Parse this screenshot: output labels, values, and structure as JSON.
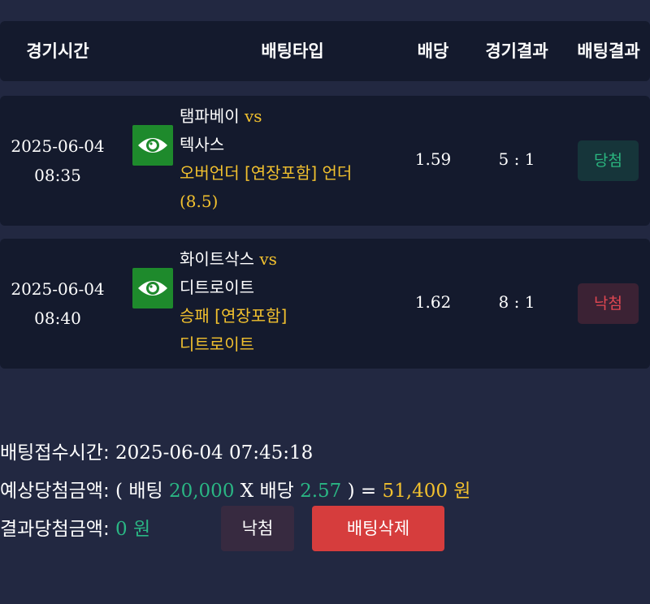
{
  "header": {
    "time": "경기시간",
    "bet_type": "배팅타입",
    "odds": "배당",
    "match_result": "경기결과",
    "bet_result": "배팅결과"
  },
  "rows": [
    {
      "date": "2025-06-04",
      "time": "08:35",
      "home": "탬파베이",
      "vs": "vs",
      "away": "텍사스",
      "bet_line1": "오버언더 [연장포함] 언더",
      "bet_line2": "(8.5)",
      "odds": "1.59",
      "score": "5 : 1",
      "result": "당첨",
      "result_color": "#2ab67f",
      "icon": "eye-icon"
    },
    {
      "date": "2025-06-04",
      "time": "08:40",
      "home": "화이트삭스",
      "vs": "vs",
      "away": "디트로이트",
      "bet_line1": "승패 [연장포함]",
      "bet_line2": "디트로이트",
      "odds": "1.62",
      "score": "8 : 1",
      "result": "낙첨",
      "result_color": "#e04752",
      "icon": "eye-icon"
    }
  ],
  "summary": {
    "receipt_label": "배팅접수시간:",
    "receipt_time": "2025-06-04 07:45:18",
    "expected_label": "예상당첨금액:",
    "open_paren": "(",
    "bet_word": "배팅",
    "bet_amount": "20,000",
    "times": "X",
    "odds_word": "배당",
    "total_odds": "2.57",
    "close_eq": ") =",
    "expected_amount": "51,400",
    "won": "원",
    "actual_label": "결과당첨금액:",
    "actual_amount": "0",
    "actual_won": "원"
  },
  "buttons": {
    "lose": "낙첨",
    "delete": "배팅삭제"
  },
  "colors": {
    "background": "#222841",
    "panel": "#141a2d",
    "accent_yellow": "#f2c12e",
    "accent_green": "#2ab684",
    "danger": "#d63d3d"
  }
}
